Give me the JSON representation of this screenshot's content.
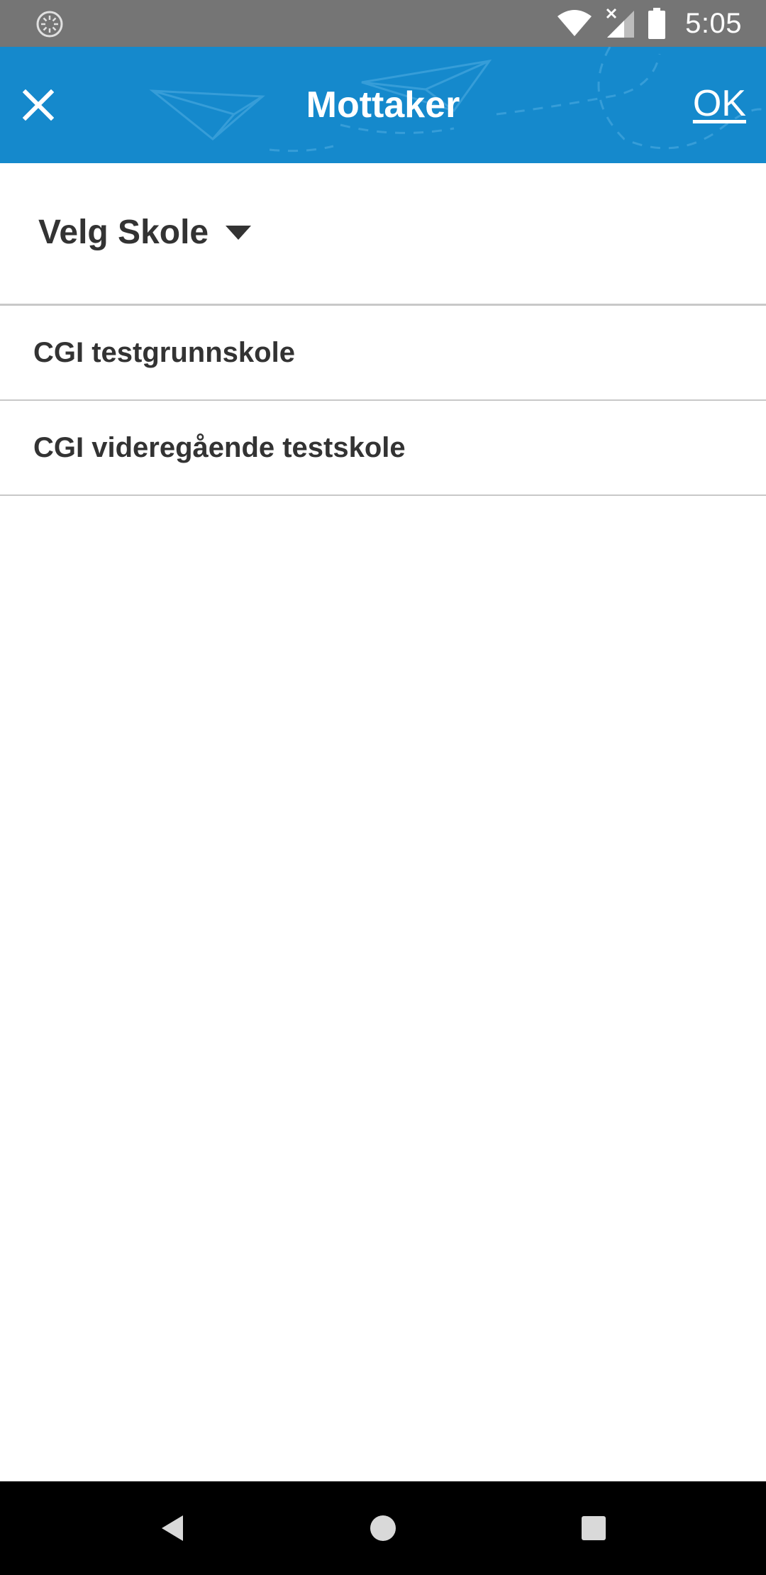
{
  "status_bar": {
    "time": "5:05",
    "icons": [
      "sync-icon",
      "wifi-icon",
      "cell-signal-off-icon",
      "battery-icon"
    ]
  },
  "app_bar": {
    "title": "Mottaker",
    "close_icon": "close-icon",
    "ok_label": "OK",
    "background_color": "#1589cc"
  },
  "selector": {
    "label": "Velg Skole",
    "icon": "caret-down-icon"
  },
  "schools": [
    {
      "name": "CGI testgrunnskole"
    },
    {
      "name": "CGI videregående testskole"
    }
  ],
  "nav_bar": {
    "buttons": [
      "back-icon",
      "home-icon",
      "recents-icon"
    ]
  }
}
